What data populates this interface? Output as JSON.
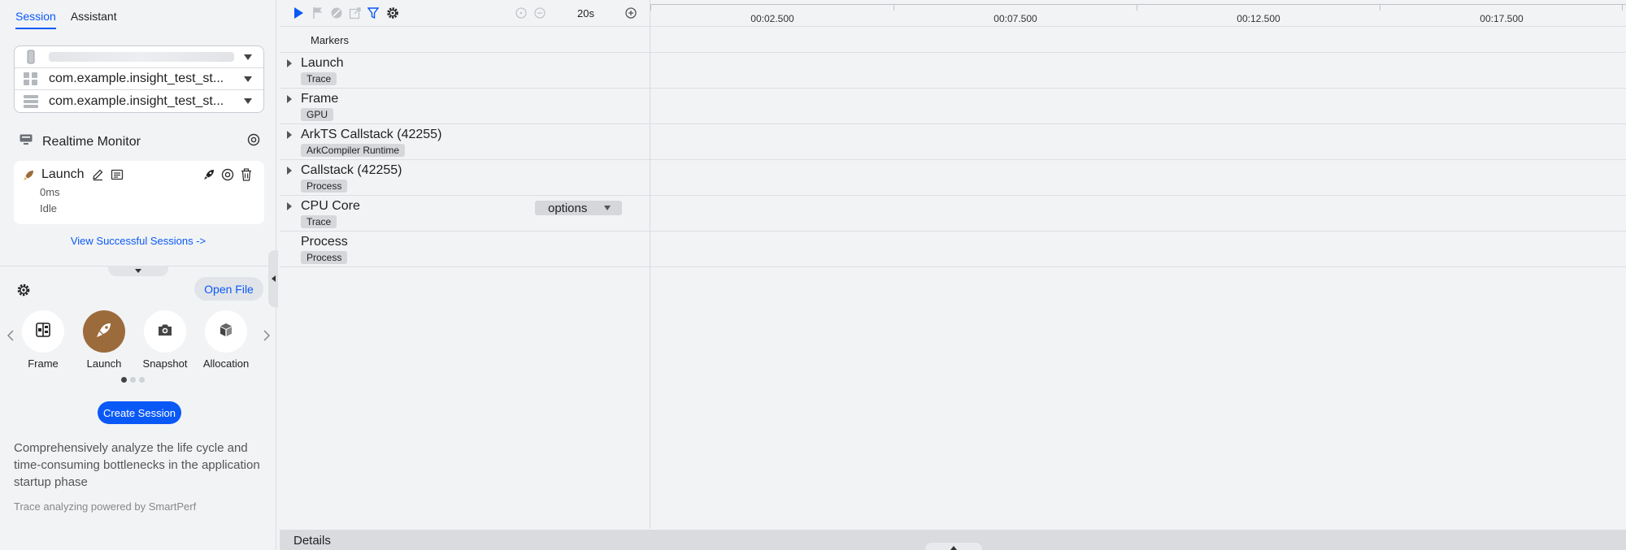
{
  "tabs": [
    {
      "label": "Session",
      "active": true
    },
    {
      "label": "Assistant",
      "active": false
    }
  ],
  "device_selector": {
    "device": "",
    "app": "com.example.insight_test_st...",
    "process": "com.example.insight_test_st..."
  },
  "realtime_monitor": {
    "title": "Realtime Monitor",
    "session": {
      "title": "Launch",
      "time": "0ms",
      "status": "Idle"
    }
  },
  "view_sessions_link": "View Successful Sessions ->",
  "open_file_label": "Open File",
  "templates": [
    {
      "label": "Frame",
      "icon": "frame-icon",
      "active": false
    },
    {
      "label": "Launch",
      "icon": "rocket-icon",
      "active": true
    },
    {
      "label": "Snapshot",
      "icon": "camera-icon",
      "active": false
    },
    {
      "label": "Allocation",
      "icon": "cube-icon",
      "active": false
    }
  ],
  "create_session_label": "Create Session",
  "description": "Comprehensively analyze the life cycle and time-consuming bottlenecks in the application startup phase",
  "powered_by": "Trace analyzing powered by SmartPerf",
  "toolbar": {
    "zoom": "20s"
  },
  "timeline": {
    "ticks": [
      "00:02.500",
      "00:07.500",
      "00:12.500",
      "00:17.500"
    ]
  },
  "markers_label": "Markers",
  "lanes": [
    {
      "name": "Launch",
      "badge": "Trace",
      "expandable": true
    },
    {
      "name": "Frame",
      "badge": "GPU",
      "expandable": true
    },
    {
      "name": "ArkTS Callstack (42255)",
      "badge": "ArkCompiler Runtime",
      "expandable": true
    },
    {
      "name": "Callstack (42255)",
      "badge": "Process",
      "expandable": true
    },
    {
      "name": "CPU Core",
      "badge": "Trace",
      "expandable": true,
      "options": "options"
    },
    {
      "name": "Process",
      "badge": "Process",
      "expandable": false
    }
  ],
  "details_label": "Details",
  "colors": {
    "accent": "#0a59f7",
    "launch_tile": "#9c6b3c"
  }
}
